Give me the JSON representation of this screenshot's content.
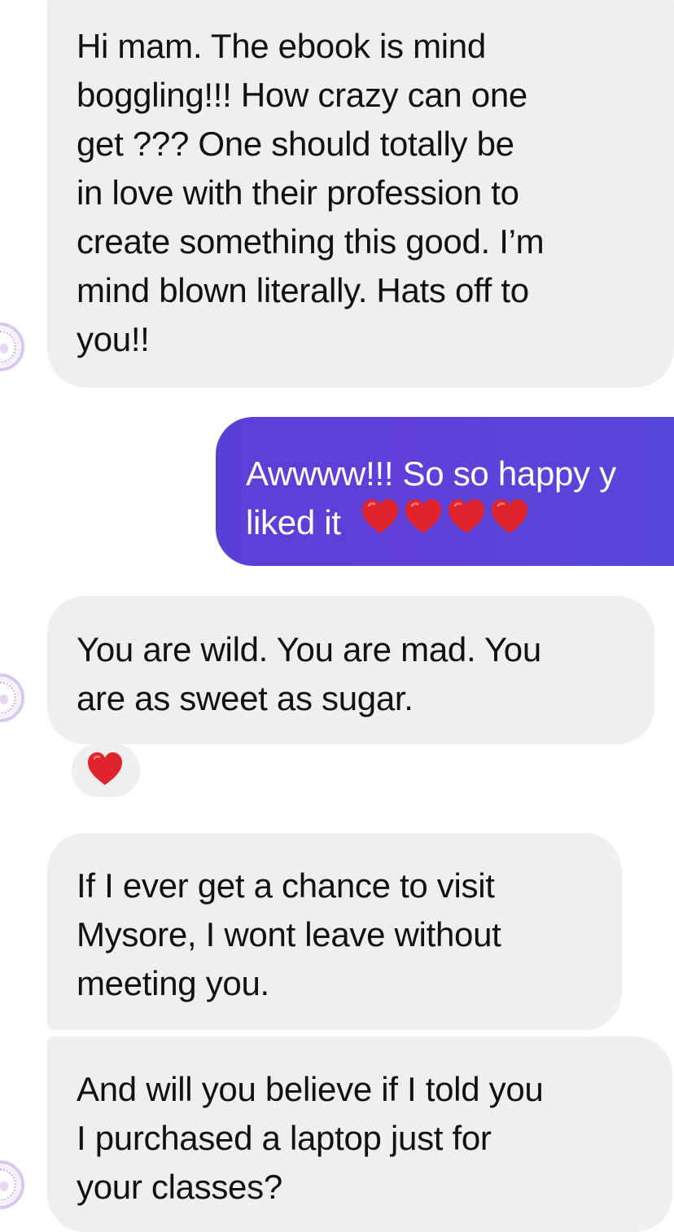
{
  "messages": [
    {
      "direction": "incoming",
      "text": "Hi mam. The ebook is mind\nboggling!!! How crazy can one\nget ??? One should totally be\nin love with their profession to\ncreate something this good. I’m\nmind blown literally. Hats off to\nyou!!"
    },
    {
      "direction": "outgoing",
      "text": "Awwww!!! So so happy y\nliked it",
      "emoji": [
        "red-heart",
        "red-heart",
        "red-heart",
        "red-heart"
      ]
    },
    {
      "direction": "incoming",
      "text": "You are wild. You are mad. You\nare as sweet as sugar.",
      "reaction": "red-heart"
    },
    {
      "direction": "incoming",
      "text": "If I ever get a chance to visit\nMysore, I wont leave without\nmeeting you."
    },
    {
      "direction": "incoming",
      "text": "And will you believe if I told you\nI purchased a laptop just for\nyour classes?"
    }
  ],
  "colors": {
    "incoming_bubble": "#efefef",
    "outgoing_bubble": "#5a3fd6",
    "incoming_text": "#111111",
    "outgoing_text": "#ffffff",
    "heart": "#e0242d"
  },
  "avatar_icon": "contact-avatar-icon"
}
